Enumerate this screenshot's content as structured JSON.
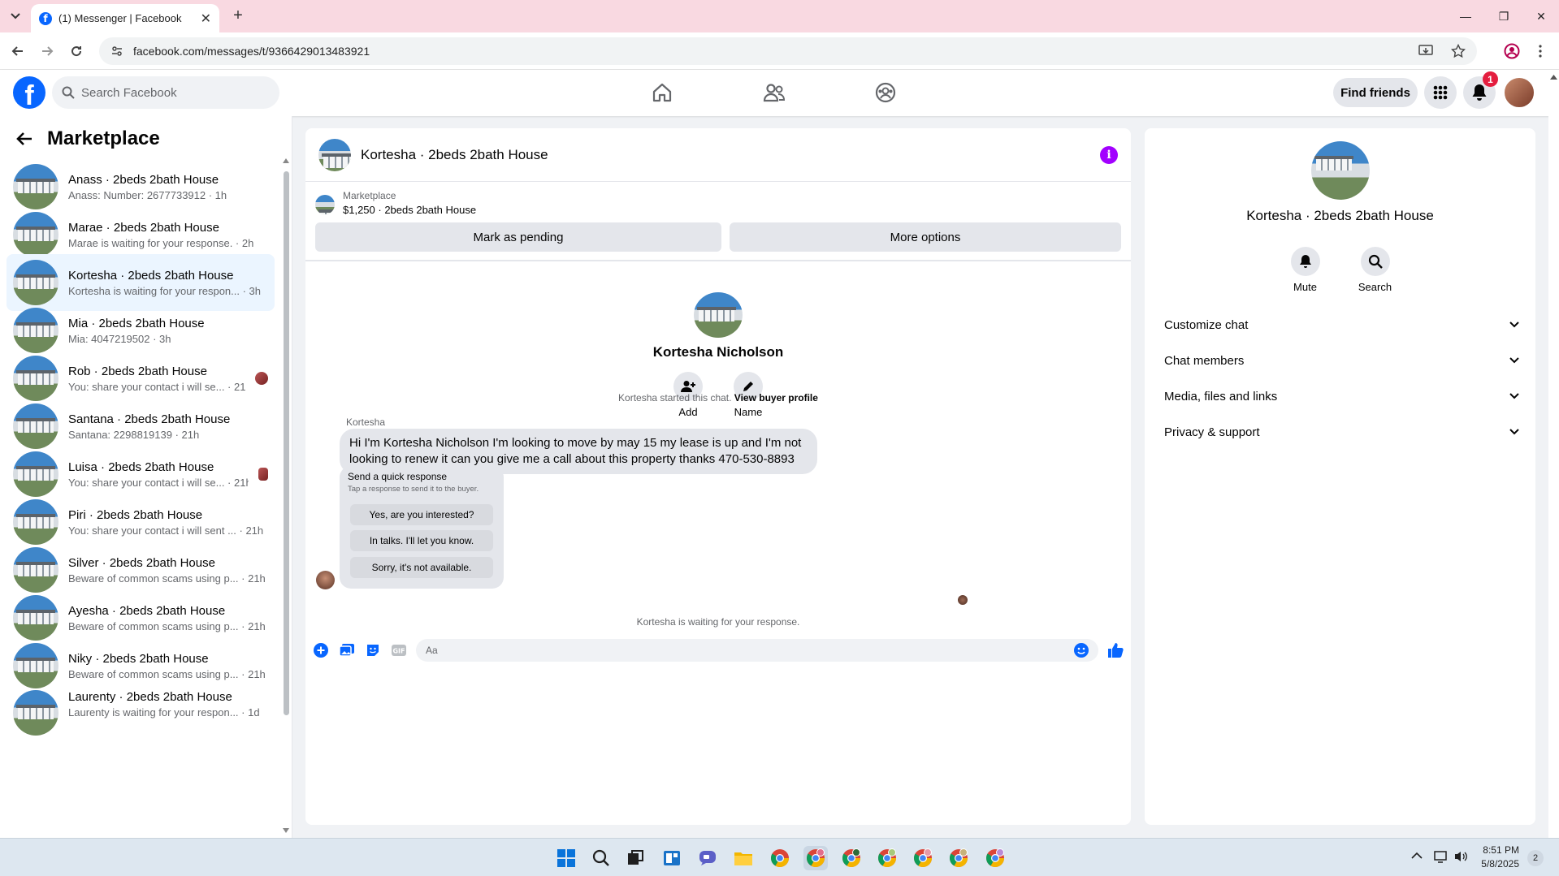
{
  "browser": {
    "tab_title": "(1) Messenger | Facebook",
    "url": "facebook.com/messages/t/9366429013483921"
  },
  "fb_header": {
    "search_placeholder": "Search Facebook",
    "find_friends": "Find friends",
    "notification_count": "1"
  },
  "sidebar": {
    "title": "Marketplace",
    "conversations": [
      {
        "name": "Anass · 2beds 2bath House",
        "last": "Anass: Number: 2677733912 · 1h"
      },
      {
        "name": "Marae · 2beds 2bath House",
        "last": "Marae is waiting for your response. · 2h"
      },
      {
        "name": "Kortesha · 2beds 2bath House",
        "last": "Kortesha is waiting for your respon... · 3h"
      },
      {
        "name": "Mia · 2beds 2bath House",
        "last": "Mia: 4047219502 · 3h"
      },
      {
        "name": "Rob · 2beds 2bath House",
        "last": "You: share your contact i will se... · 21h"
      },
      {
        "name": "Santana · 2beds 2bath House",
        "last": "Santana: 2298819139 · 21h"
      },
      {
        "name": "Luisa · 2beds 2bath House",
        "last": "You: share your contact i will se... · 21h"
      },
      {
        "name": "Piri · 2beds 2bath House",
        "last": "You: share your contact i will sent ... · 21h"
      },
      {
        "name": "Silver · 2beds 2bath House",
        "last": "Beware of common scams using p... · 21h"
      },
      {
        "name": "Ayesha · 2beds 2bath House",
        "last": "Beware of common scams using p... · 21h"
      },
      {
        "name": "Niky · 2beds 2bath House",
        "last": "Beware of common scams using p... · 21h"
      },
      {
        "name": "Laurenty · 2beds 2bath House",
        "last": "Laurenty is waiting for your respon... · 1d"
      }
    ]
  },
  "chat": {
    "title": "Kortesha · 2beds 2bath House",
    "marketplace_label": "Marketplace",
    "listing": "$1,250 · 2beds 2bath House",
    "mark_pending": "Mark as pending",
    "more_options": "More options",
    "contact_name": "Kortesha Nicholson",
    "add_label": "Add",
    "name_label": "Name",
    "started_text": "Kortesha started this chat.",
    "view_buyer_profile": "View buyer profile",
    "sender": "Kortesha",
    "message": "Hi I'm Kortesha Nicholson I'm looking to move by may 15 my lease is up and I'm not looking to renew it can you give me a call about this property thanks 470-530-8893",
    "quick_title": "Send a quick response",
    "quick_sub": "Tap a response to send it to the buyer.",
    "quick_replies": [
      "Yes, are you interested?",
      "In talks. I'll let you know.",
      "Sorry, it's not available."
    ],
    "waiting_text": "Kortesha is waiting for your response.",
    "input_placeholder": "Aa"
  },
  "info_panel": {
    "name": "Kortesha · 2beds 2bath House",
    "mute": "Mute",
    "search": "Search",
    "sections": [
      "Customize chat",
      "Chat members",
      "Media, files and links",
      "Privacy & support"
    ]
  },
  "taskbar": {
    "time": "8:51 PM",
    "date": "5/8/2025",
    "notif": "2"
  },
  "colors": {
    "fb_blue": "#0866ff",
    "active_conv": "#ebf5ff",
    "info_purple": "#a200ff",
    "badge_red": "#e41e3f"
  }
}
